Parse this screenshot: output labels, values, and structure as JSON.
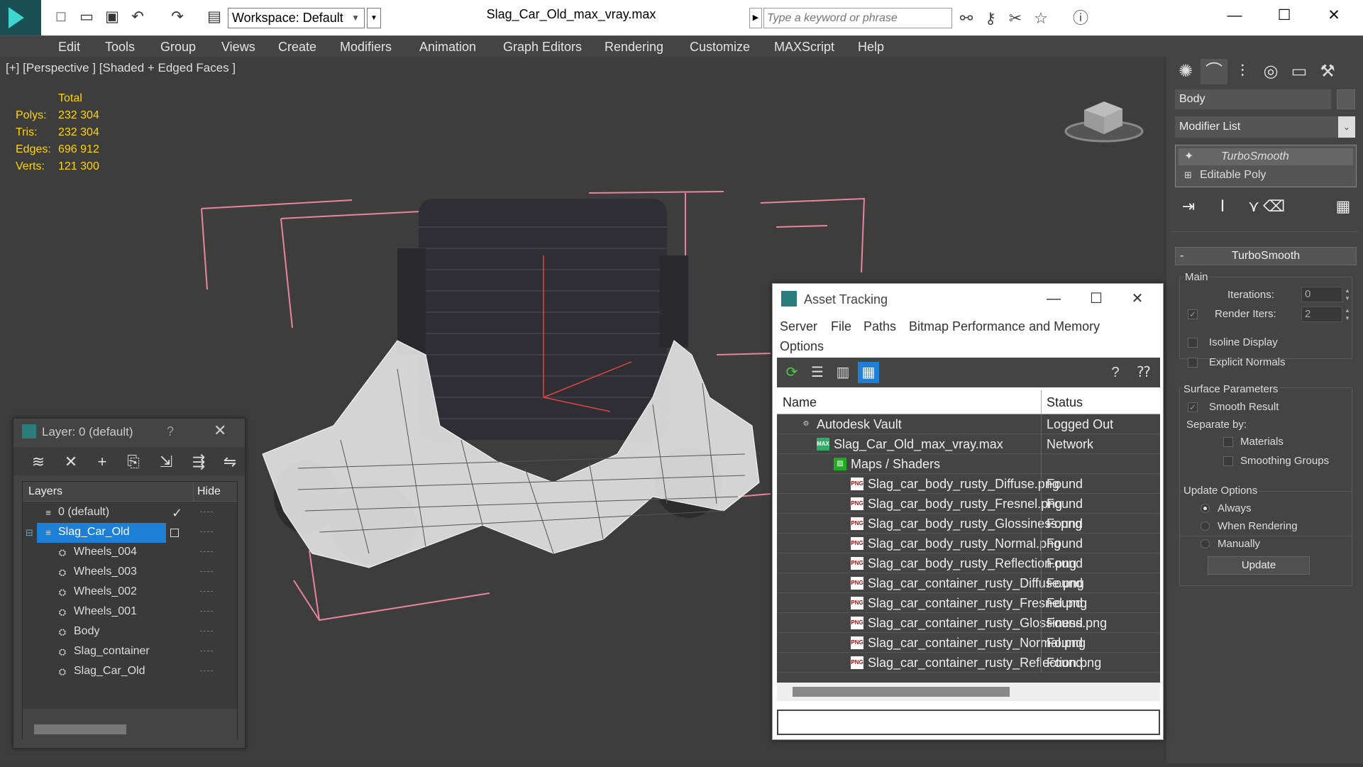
{
  "titlebar": {
    "workspace_label": "Workspace: Default",
    "document_title": "Slag_Car_Old_max_vray.max",
    "search_placeholder": "Type a keyword or phrase"
  },
  "menu": [
    "Edit",
    "Tools",
    "Group",
    "Views",
    "Create",
    "Modifiers",
    "Animation",
    "Graph Editors",
    "Rendering",
    "Customize",
    "MAXScript",
    "Help"
  ],
  "viewport": {
    "label": "[+] [Perspective ] [Shaded + Edged Faces ]",
    "stats_header": "Total",
    "stats": [
      {
        "label": "Polys:",
        "value": "232 304"
      },
      {
        "label": "Tris:",
        "value": "232 304"
      },
      {
        "label": "Edges:",
        "value": "696 912"
      },
      {
        "label": "Verts:",
        "value": "121 300"
      }
    ]
  },
  "command_panel": {
    "object_name": "Body",
    "modifier_list": "Modifier List",
    "stack": [
      {
        "label": "TurboSmooth",
        "icon": "lightbulb-icon"
      },
      {
        "label": "Editable Poly",
        "icon": "plus-icon"
      }
    ],
    "rollout_title": "TurboSmooth",
    "main_group": "Main",
    "iterations_label": "Iterations:",
    "iterations_value": "0",
    "render_iters_label": "Render Iters:",
    "render_iters_value": "2",
    "isoline_label": "Isoline Display",
    "explicit_normals_label": "Explicit Normals",
    "surface_group": "Surface Parameters",
    "smooth_result_label": "Smooth Result",
    "separate_by_label": "Separate by:",
    "materials_label": "Materials",
    "smoothing_groups_label": "Smoothing Groups",
    "update_group": "Update Options",
    "always_label": "Always",
    "when_rendering_label": "When Rendering",
    "manually_label": "Manually",
    "update_button": "Update"
  },
  "layer_panel": {
    "title": "Layer: 0 (default)",
    "help": "?",
    "col_layers": "Layers",
    "col_hide": "Hide",
    "rows": [
      {
        "name": "0 (default)",
        "icon": "layer-icon",
        "indent": 0
      },
      {
        "name": "Slag_Car_Old",
        "icon": "layer-icon",
        "indent": 0,
        "selected": true
      },
      {
        "name": "Wheels_004",
        "icon": "teapot-icon",
        "indent": 1
      },
      {
        "name": "Wheels_003",
        "icon": "teapot-icon",
        "indent": 1
      },
      {
        "name": "Wheels_002",
        "icon": "teapot-icon",
        "indent": 1
      },
      {
        "name": "Wheels_001",
        "icon": "teapot-icon",
        "indent": 1
      },
      {
        "name": "Body",
        "icon": "teapot-icon",
        "indent": 1
      },
      {
        "name": "Slag_container",
        "icon": "teapot-icon",
        "indent": 1
      },
      {
        "name": "Slag_Car_Old",
        "icon": "teapot-icon",
        "indent": 1
      }
    ]
  },
  "asset_panel": {
    "title": "Asset Tracking",
    "menu": [
      "Server",
      "File",
      "Paths",
      "Bitmap Performance and Memory",
      "Options"
    ],
    "col_name": "Name",
    "col_status": "Status",
    "rows": [
      {
        "name": "Autodesk Vault",
        "status": "Logged Out",
        "icon": "vault-icon",
        "level": 0
      },
      {
        "name": "Slag_Car_Old_max_vray.max",
        "status": "Network",
        "icon": "max-file-icon",
        "level": 1
      },
      {
        "name": "Maps / Shaders",
        "status": "",
        "icon": "maps-icon",
        "level": 2
      },
      {
        "name": "Slag_car_body_rusty_Diffuse.png",
        "status": "Found",
        "icon": "png-icon",
        "level": 3
      },
      {
        "name": "Slag_car_body_rusty_Fresnel.png",
        "status": "Found",
        "icon": "png-icon",
        "level": 3
      },
      {
        "name": "Slag_car_body_rusty_Glossiness.png",
        "status": "Found",
        "icon": "png-icon",
        "level": 3
      },
      {
        "name": "Slag_car_body_rusty_Normal.png",
        "status": "Found",
        "icon": "png-icon",
        "level": 3
      },
      {
        "name": "Slag_car_body_rusty_Reflection.png",
        "status": "Found",
        "icon": "png-icon",
        "level": 3
      },
      {
        "name": "Slag_car_container_rusty_Diffuse.png",
        "status": "Found",
        "icon": "png-icon",
        "level": 3
      },
      {
        "name": "Slag_car_container_rusty_Fresnel.png",
        "status": "Found",
        "icon": "png-icon",
        "level": 3
      },
      {
        "name": "Slag_car_container_rusty_Glossiness.png",
        "status": "Found",
        "icon": "png-icon",
        "level": 3
      },
      {
        "name": "Slag_car_container_rusty_Normal.png",
        "status": "Found",
        "icon": "png-icon",
        "level": 3
      },
      {
        "name": "Slag_car_container_rusty_Reflection.png",
        "status": "Found",
        "icon": "png-icon",
        "level": 3
      }
    ]
  },
  "colors": {
    "accent": "#1e7fd6",
    "stat_text": "#ffd400",
    "bbox_lines": "#e8849c",
    "selection": "#1e7fd6"
  }
}
